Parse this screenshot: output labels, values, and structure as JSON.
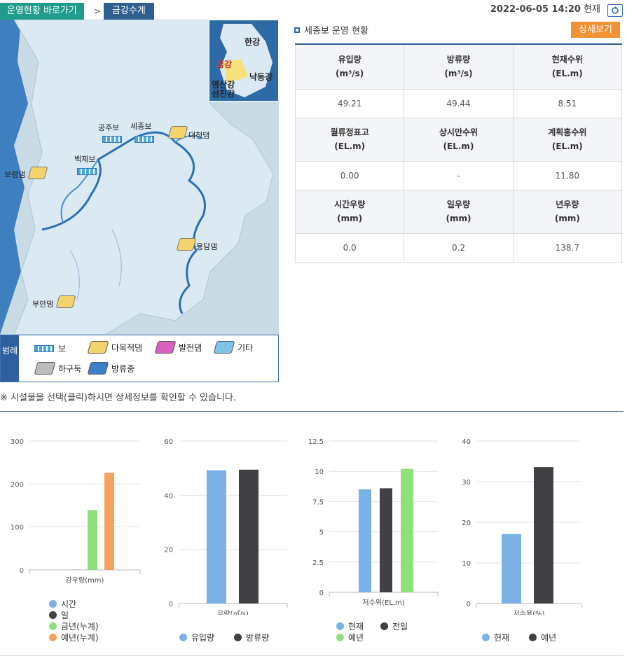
{
  "breadcrumb": {
    "home": "운영현황 바로가기",
    "separator": ">",
    "current": "금강수계"
  },
  "datetime": "2022-06-05 14:20",
  "datetime_suffix": "현재",
  "map": {
    "facilities": [
      {
        "label": "공주보",
        "type": "weir"
      },
      {
        "label": "세종보",
        "type": "weir"
      },
      {
        "label": "백제보",
        "type": "weir"
      },
      {
        "label": "대청댐",
        "type": "multipurpose"
      },
      {
        "label": "보령댐",
        "type": "multipurpose"
      },
      {
        "label": "용담댐",
        "type": "multipurpose"
      },
      {
        "label": "부안댐",
        "type": "multipurpose"
      }
    ],
    "inset": {
      "han": "한강",
      "geum": "금강",
      "nakdong": "낙동강",
      "yeongsan": "영산강",
      "seomjin": "섬진강"
    }
  },
  "legend": {
    "tag": "범례",
    "items": [
      {
        "label": "보",
        "color": "#4aa8e0"
      },
      {
        "label": "다목적댐",
        "color": "#f3d36b"
      },
      {
        "label": "발전댐",
        "color": "#d95fc0"
      },
      {
        "label": "기타",
        "color": "#7fc4e8"
      },
      {
        "label": "하구둑",
        "color": "#bdbdbd"
      },
      {
        "label": "방류중",
        "color": "#3a7fc8"
      }
    ]
  },
  "notice": "※ 시설물을 선택(클릭)하시면 상세정보를 확인할 수 있습니다.",
  "panel": {
    "title": "세종보 운영 현황",
    "detail_button": "상세보기",
    "rows": [
      {
        "headers": [
          [
            "유입량",
            "(m³/s)"
          ],
          [
            "방류량",
            "(m³/s)"
          ],
          [
            "현재수위",
            "(EL.m)"
          ]
        ],
        "values": [
          "49.21",
          "49.44",
          "8.51"
        ]
      },
      {
        "headers": [
          [
            "월류정표고",
            "(EL.m)"
          ],
          [
            "상시만수위",
            "(EL.m)"
          ],
          [
            "계획홍수위",
            "(EL.m)"
          ]
        ],
        "values": [
          "0.00",
          "-",
          "11.80"
        ]
      },
      {
        "headers": [
          [
            "시간우량",
            "(mm)"
          ],
          [
            "일우량",
            "(mm)"
          ],
          [
            "년우량",
            "(mm)"
          ]
        ],
        "values": [
          "0.0",
          "0.2",
          "138.7"
        ]
      }
    ]
  },
  "colors": {
    "blue": "#7ab2e8",
    "dark": "#404045",
    "green": "#8ee07a",
    "orange": "#f5a25d"
  },
  "chart_data": [
    {
      "type": "bar",
      "xlabel": "강우량(mm)",
      "categories": [
        ""
      ],
      "ylim": [
        0,
        300
      ],
      "yticks": [
        0,
        100,
        200,
        300
      ],
      "series": [
        {
          "name": "시간",
          "values": [
            0.0
          ],
          "color": "#7ab2e8"
        },
        {
          "name": "일",
          "values": [
            0.2
          ],
          "color": "#404045"
        },
        {
          "name": "금년(누계)",
          "values": [
            138.7
          ],
          "color": "#8ee07a"
        },
        {
          "name": "예년(누계)",
          "values": [
            226
          ],
          "color": "#f5a25d"
        }
      ]
    },
    {
      "type": "bar",
      "xlabel": "유량(㎥/s)",
      "categories": [
        ""
      ],
      "ylim": [
        0,
        60
      ],
      "yticks": [
        0,
        20,
        40,
        60
      ],
      "series": [
        {
          "name": "유입량",
          "values": [
            49.21
          ],
          "color": "#7ab2e8"
        },
        {
          "name": "방류량",
          "values": [
            49.44
          ],
          "color": "#404045"
        }
      ]
    },
    {
      "type": "bar",
      "xlabel": "저수위(EL.m)",
      "categories": [
        ""
      ],
      "ylim": [
        0,
        12.5
      ],
      "yticks": [
        0,
        2.5,
        5,
        7.5,
        10,
        12.5
      ],
      "series": [
        {
          "name": "현재",
          "values": [
            8.51
          ],
          "color": "#7ab2e8"
        },
        {
          "name": "전일",
          "values": [
            8.6
          ],
          "color": "#404045"
        },
        {
          "name": "예년",
          "values": [
            10.2
          ],
          "color": "#8ee07a"
        }
      ]
    },
    {
      "type": "bar",
      "xlabel": "저수율(%)",
      "categories": [
        ""
      ],
      "ylim": [
        0,
        40
      ],
      "yticks": [
        0,
        10,
        20,
        30,
        40
      ],
      "series": [
        {
          "name": "현재",
          "values": [
            17.1
          ],
          "color": "#7ab2e8"
        },
        {
          "name": "예년",
          "values": [
            33.6
          ],
          "color": "#404045"
        }
      ]
    }
  ]
}
